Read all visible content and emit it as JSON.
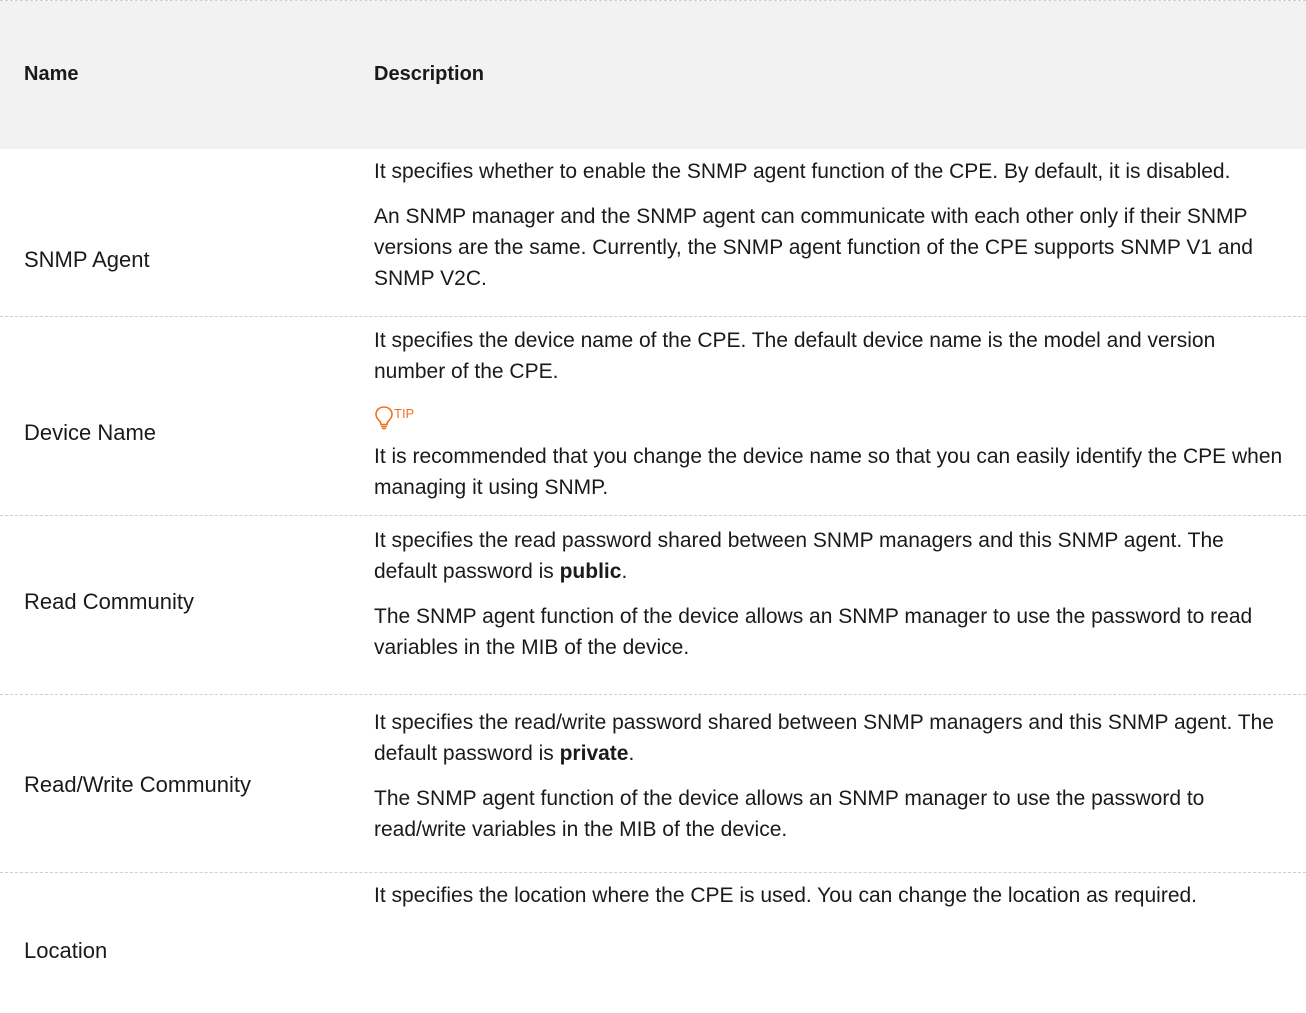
{
  "header": {
    "name": "Name",
    "description": "Description"
  },
  "rows": [
    {
      "name": "SNMP Agent",
      "p1": "It specifies whether to enable the SNMP agent function of the CPE. By default, it is disabled.",
      "p2": "An SNMP manager and the SNMP agent can communicate with each other only if their SNMP versions are the same. Currently, the SNMP agent function of the CPE supports SNMP V1 and SNMP V2C."
    },
    {
      "name": "Device Name",
      "p1": "It specifies the device name of the CPE. The default device name is the model and version number of the CPE.",
      "tip_label": "TIP",
      "p2": "It is recommended that you change the device name so that you can easily identify the CPE when managing it using SNMP."
    },
    {
      "name": "Read Community",
      "p1_pre": "It specifies the read password shared between SNMP managers and this SNMP agent. The default password is ",
      "p1_bold": "public",
      "p1_post": ".",
      "p2": "The SNMP agent function of the device allows an SNMP manager to use the password to read variables in the MIB of the device."
    },
    {
      "name": "Read/Write Community",
      "p1_pre": "It specifies the read/write password shared between SNMP managers and this SNMP agent. The default password is ",
      "p1_bold": "private",
      "p1_post": ".",
      "p2": "The SNMP agent function of the device allows an SNMP manager to use the password to read/write variables in the MIB of the device."
    },
    {
      "name": "Location",
      "p1": "It specifies the location where the CPE is used. You can change the location as required."
    }
  ],
  "colors": {
    "tip": "#f37021",
    "header_bg": "#f2f2f2",
    "divider": "#cfcfcf"
  }
}
